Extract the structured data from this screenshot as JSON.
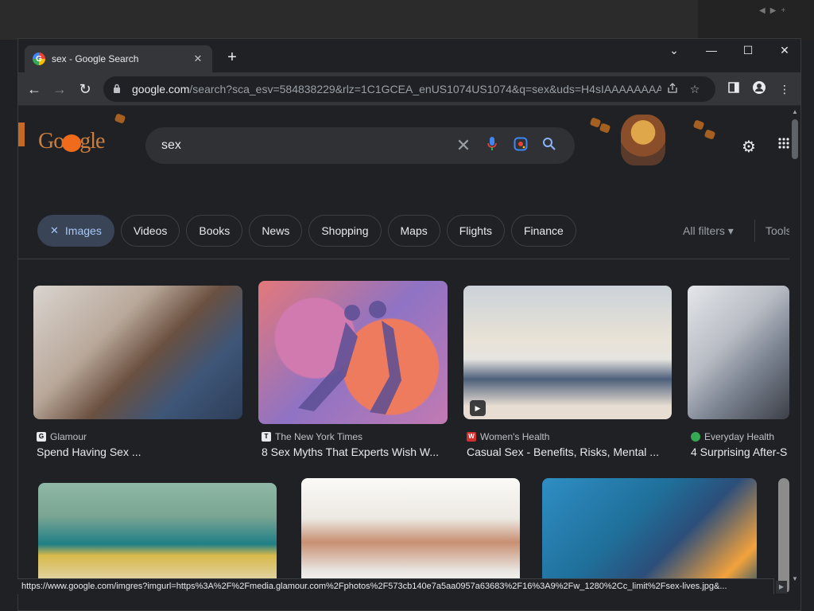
{
  "browser": {
    "tab_title": "sex - Google Search",
    "tab_favicon_letter": "G",
    "tab_close": "✕",
    "new_tab": "+",
    "window_controls": [
      "⌄",
      "—",
      "☐",
      "✕"
    ],
    "url_host": "google.com",
    "url_rest": "/search?sca_esv=584838229&rlz=1C1GCEA_enUS1074US1074&q=sex&uds=H4sIAAAAAAAA_...",
    "nav_icons": {
      "back": "←",
      "forward": "→",
      "reload": "↻"
    }
  },
  "page": {
    "logo_text_left": "Go",
    "logo_text_right": "gle",
    "search_value": "sex",
    "chips": [
      {
        "label": "Images",
        "active": true
      },
      {
        "label": "Videos"
      },
      {
        "label": "Books"
      },
      {
        "label": "News"
      },
      {
        "label": "Shopping"
      },
      {
        "label": "Maps"
      },
      {
        "label": "Flights"
      },
      {
        "label": "Finance"
      }
    ],
    "all_filters": "All filters ▾",
    "tools": "Tools"
  },
  "results": [
    {
      "source": "Glamour",
      "title": "Spend Having Sex ...",
      "fav_letter": "G",
      "fav_color": "#e8eaed"
    },
    {
      "source": "The New York Times",
      "title": "8 Sex Myths That Experts Wish W...",
      "fav_letter": "T",
      "fav_color": "#e8eaed"
    },
    {
      "source": "Women's Health",
      "title": "Casual Sex - Benefits, Risks, Mental ...",
      "fav_letter": "W",
      "fav_color": "#d32f2f"
    },
    {
      "source": "Everyday Health",
      "title": "4 Surprising After-S",
      "fav_letter": "",
      "fav_color": "#34a853"
    }
  ],
  "status_url": "https://www.google.com/imgres?imgurl=https%3A%2F%2Fmedia.glamour.com%2Fphotos%2F573cb140e7a5aa0957a63683%2F16%3A9%2Fw_1280%2Cc_limit%2Fsex-lives.jpg&...",
  "colors": {
    "accent": "#8ab4f8",
    "chip_active_bg": "#394457",
    "background": "#202124"
  }
}
